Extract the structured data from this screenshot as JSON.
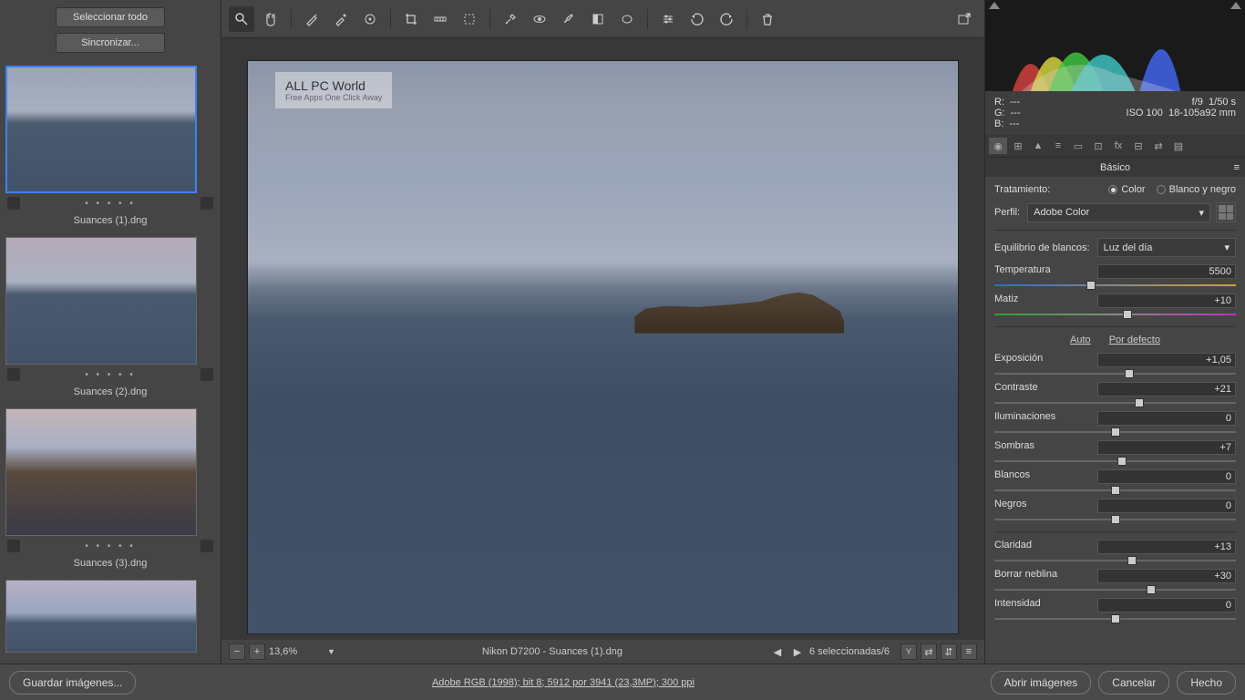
{
  "left": {
    "select_all": "Seleccionar todo",
    "sync": "Sincronizar...",
    "thumbs": [
      {
        "name": "Suances (1).dng",
        "selected": true
      },
      {
        "name": "Suances (2).dng",
        "selected": false
      },
      {
        "name": "Suances (3).dng",
        "selected": false
      },
      {
        "name": "",
        "selected": false
      }
    ]
  },
  "watermark": {
    "title": "ALL PC World",
    "sub": "Free Apps One Click Away"
  },
  "status": {
    "zoom": "13,6%",
    "info": "Nikon D7200  -  Suances (1).dng",
    "selection": "6 seleccionadas/6"
  },
  "meta": {
    "r": "R:",
    "g": "G:",
    "b": "B:",
    "dash": "---",
    "aperture": "f/9",
    "shutter": "1/50 s",
    "iso": "ISO 100",
    "lens": "18-105a92 mm"
  },
  "panel": {
    "title": "Básico",
    "treatment_label": "Tratamiento:",
    "color": "Color",
    "bw": "Blanco y negro",
    "profile_label": "Perfil:",
    "profile_value": "Adobe Color",
    "wb_label": "Equilibrio de blancos:",
    "wb_value": "Luz del día",
    "auto": "Auto",
    "default": "Por defecto"
  },
  "sliders": {
    "temp": {
      "label": "Temperatura",
      "value": "5500",
      "pos": 40
    },
    "tint": {
      "label": "Matiz",
      "value": "+10",
      "pos": 55
    },
    "exposure": {
      "label": "Exposición",
      "value": "+1,05",
      "pos": 56
    },
    "contrast": {
      "label": "Contraste",
      "value": "+21",
      "pos": 60
    },
    "highlights": {
      "label": "Iluminaciones",
      "value": "0",
      "pos": 50
    },
    "shadows": {
      "label": "Sombras",
      "value": "+7",
      "pos": 53
    },
    "whites": {
      "label": "Blancos",
      "value": "0",
      "pos": 50
    },
    "blacks": {
      "label": "Negros",
      "value": "0",
      "pos": 50
    },
    "clarity": {
      "label": "Claridad",
      "value": "+13",
      "pos": 57
    },
    "dehaze": {
      "label": "Borrar neblina",
      "value": "+30",
      "pos": 65
    },
    "vibrance": {
      "label": "Intensidad",
      "value": "0",
      "pos": 50
    }
  },
  "footer": {
    "save": "Guardar imágenes...",
    "info": "Adobe RGB (1998); bit 8; 5912 por 3941 (23,3MP); 300 ppi",
    "open": "Abrir imágenes",
    "cancel": "Cancelar",
    "done": "Hecho"
  }
}
